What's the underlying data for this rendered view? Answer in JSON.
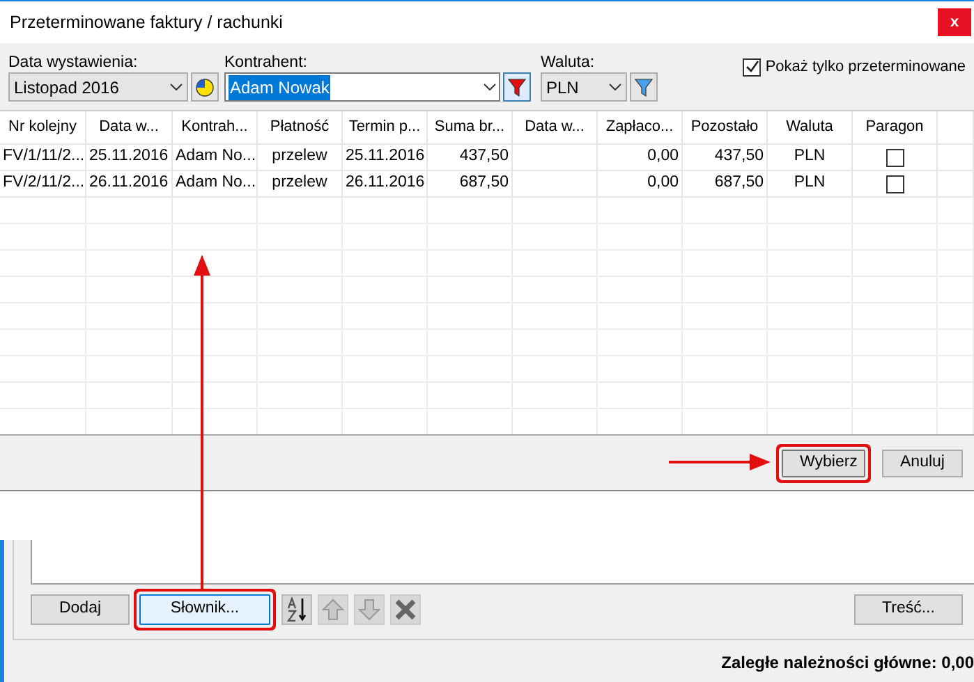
{
  "window": {
    "title": "Przeterminowane faktury / rachunki",
    "close": "x"
  },
  "filters": {
    "date_label": "Data wystawienia:",
    "date_value": "Listopad 2016",
    "contractor_label": "Kontrahent:",
    "contractor_value": "Adam Nowak",
    "currency_label": "Waluta:",
    "currency_value": "PLN",
    "overdue_only": {
      "label": "Pokaż tylko przeterminowane",
      "checked": true
    }
  },
  "table": {
    "columns": [
      "Nr kolejny",
      "Data w...",
      "Kontrah...",
      "Płatność",
      "Termin p...",
      "Suma br...",
      "Data w...",
      "Zapłaco...",
      "Pozostało",
      "Waluta",
      "Paragon"
    ],
    "rows": [
      {
        "cells": [
          "FV/1/11/2...",
          "25.11.2016",
          "Adam No...",
          "przelew",
          "25.11.2016",
          "437,50",
          "",
          "0,00",
          "437,50",
          "PLN"
        ],
        "paragon": false
      },
      {
        "cells": [
          "FV/2/11/2...",
          "26.11.2016",
          "Adam No...",
          "przelew",
          "26.11.2016",
          "687,50",
          "",
          "0,00",
          "687,50",
          "PLN"
        ],
        "paragon": false
      }
    ]
  },
  "dialog_buttons": [
    {
      "label": "Wybierz",
      "highlighted": true
    },
    {
      "label": "Anuluj",
      "highlighted": false
    }
  ],
  "background_buttons": {
    "add": "Dodaj",
    "dictionary": "Słownik...",
    "content": "Treść..."
  },
  "footer": "Zaległe należności główne: 0,00"
}
